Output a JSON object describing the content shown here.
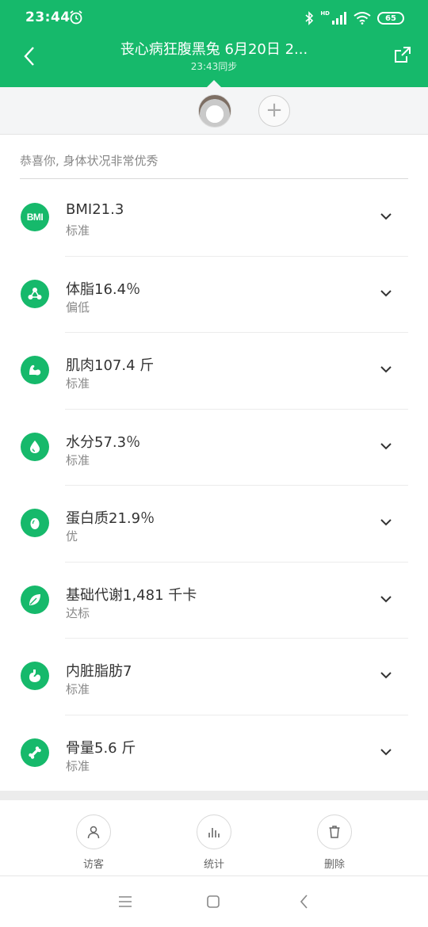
{
  "status_bar": {
    "time": "23:44",
    "battery": "65",
    "network": "HD"
  },
  "header": {
    "title": "丧心病狂腹黑兔 6月20日 2...",
    "subtitle": "23:43同步"
  },
  "summary": "恭喜你, 身体状况非常优秀",
  "metrics": [
    {
      "name": "BMI21.3",
      "status": "标准",
      "icon": "bmi-icon"
    },
    {
      "name": "体脂16.4％",
      "status": "偏低",
      "icon": "body-fat-icon"
    },
    {
      "name": "肌肉107.4 斤",
      "status": "标准",
      "icon": "muscle-icon"
    },
    {
      "name": "水分57.3％",
      "status": "标准",
      "icon": "water-drop-icon"
    },
    {
      "name": "蛋白质21.9％",
      "status": "优",
      "icon": "egg-icon"
    },
    {
      "name": "基础代谢1,481 千卡",
      "status": "达标",
      "icon": "leaf-icon"
    },
    {
      "name": "内脏脂肪7",
      "status": "标准",
      "icon": "stomach-icon"
    },
    {
      "name": "骨量5.6 斤",
      "status": "标准",
      "icon": "bone-icon"
    }
  ],
  "bmi_badge": "BMI",
  "actions": {
    "visitor": "访客",
    "stats": "统计",
    "delete": "删除"
  },
  "colors": {
    "accent": "#16b96b"
  }
}
